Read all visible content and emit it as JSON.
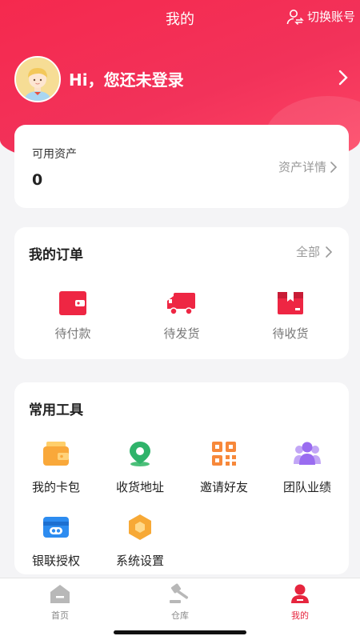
{
  "header": {
    "title": "我的",
    "switch_account": "切换账号",
    "greeting": "Hi，您还未登录"
  },
  "assets": {
    "label": "可用资产",
    "value": "0",
    "detail_link": "资产详情"
  },
  "orders": {
    "title": "我的订单",
    "all_link": "全部",
    "items": [
      {
        "label": "待付款",
        "icon": "wallet-icon"
      },
      {
        "label": "待发货",
        "icon": "truck-icon"
      },
      {
        "label": "待收货",
        "icon": "box-icon"
      }
    ]
  },
  "tools": {
    "title": "常用工具",
    "items": [
      {
        "label": "我的卡包",
        "icon": "card-wallet-icon"
      },
      {
        "label": "收货地址",
        "icon": "location-pin-icon"
      },
      {
        "label": "邀请好友",
        "icon": "qr-code-icon"
      },
      {
        "label": "团队业绩",
        "icon": "team-icon"
      },
      {
        "label": "银联授权",
        "icon": "bank-card-icon"
      },
      {
        "label": "系统设置",
        "icon": "settings-hexagon-icon"
      }
    ]
  },
  "tabbar": {
    "tabs": [
      {
        "label": "首页",
        "icon": "home-icon"
      },
      {
        "label": "仓库",
        "icon": "auction-hammer-icon"
      },
      {
        "label": "我的",
        "icon": "profile-icon",
        "active": true
      }
    ]
  },
  "colors": {
    "brand_red": "#f2294f",
    "active_tab": "#e6253e",
    "muted_text": "#999999"
  }
}
